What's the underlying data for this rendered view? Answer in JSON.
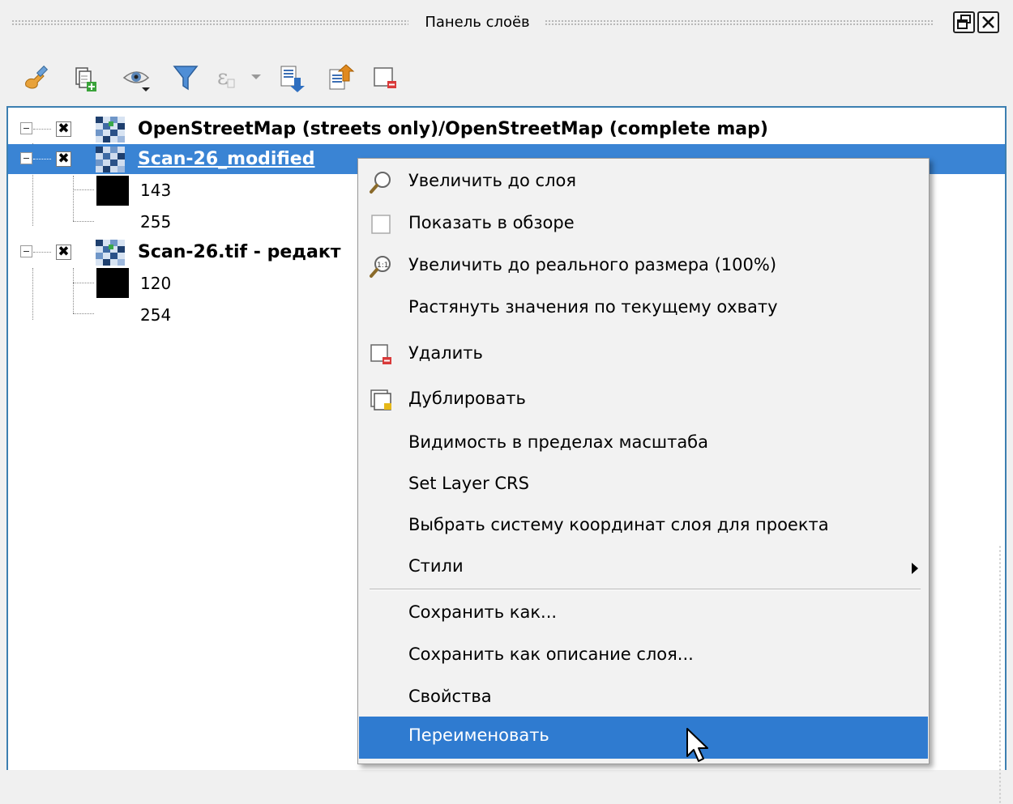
{
  "panel": {
    "title": "Панель слоёв",
    "float_button_glyph": "🗗",
    "close_button_glyph": "✕"
  },
  "toolbar": {
    "icons": [
      "style-brush-icon",
      "add-group-icon",
      "visibility-eye-icon",
      "filter-icon",
      "filter-expression-icon",
      "expand-all-icon",
      "collapse-all-icon",
      "remove-layer-icon"
    ]
  },
  "tree": {
    "layers": [
      {
        "name": "OpenStreetMap (streets only)/OpenStreetMap (complete map)",
        "checked": true,
        "selected": false,
        "legend": []
      },
      {
        "name": "Scan-26_modified",
        "checked": true,
        "selected": true,
        "legend": [
          "143",
          "255"
        ]
      },
      {
        "name": "Scan-26.tif - редакт",
        "checked": true,
        "selected": false,
        "legend": [
          "120",
          "254"
        ]
      }
    ]
  },
  "context_menu": {
    "items": [
      {
        "label": "Увеличить до слоя",
        "icon": "zoom-to-layer-icon"
      },
      {
        "label": "Показать в обзоре",
        "icon": "checkbox-icon"
      },
      {
        "label": "Увеличить до реального размера (100%)",
        "icon": "zoom-actual-size-icon"
      },
      {
        "label": "Растянуть значения по текущему охвату",
        "icon": ""
      },
      {
        "label": "Удалить",
        "icon": "remove-layer-icon"
      },
      {
        "label": "Дублировать",
        "icon": "duplicate-layer-icon"
      },
      {
        "label": "Видимость в пределах масштаба",
        "icon": ""
      },
      {
        "label": "Set Layer CRS",
        "icon": ""
      },
      {
        "label": "Выбрать систему координат слоя для проекта",
        "icon": ""
      },
      {
        "label": "Стили",
        "icon": "",
        "submenu": true
      },
      {
        "label": "Сохранить как...",
        "icon": ""
      },
      {
        "label": "Сохранить как описание слоя...",
        "icon": ""
      },
      {
        "label": "Свойства",
        "icon": ""
      },
      {
        "label": "Переименовать",
        "icon": "",
        "highlighted": true
      }
    ]
  },
  "colors": {
    "selection": "#3a84d4",
    "menu_highlight": "#2f7bd0",
    "tree_border": "#3c7fb1"
  }
}
